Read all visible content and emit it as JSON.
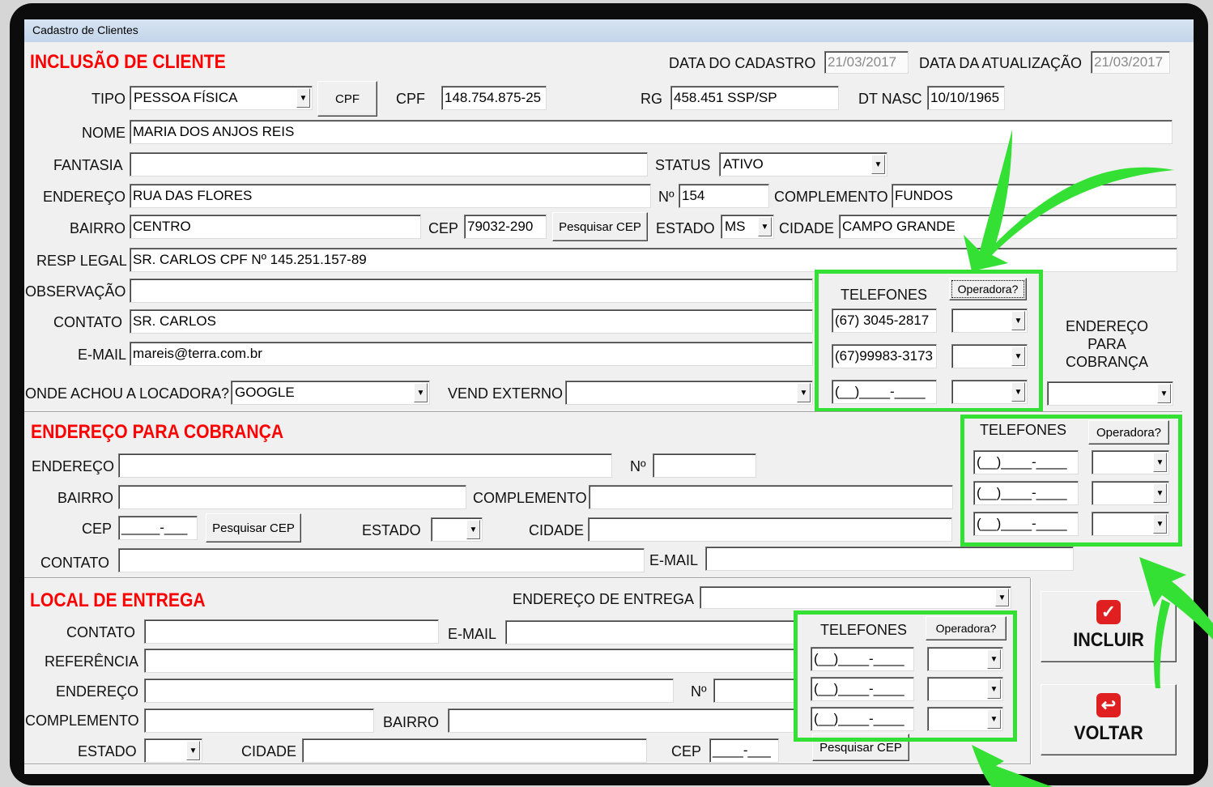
{
  "window": {
    "title": "Cadastro de Clientes"
  },
  "inclusao": {
    "header": "INCLUSÃO DE CLIENTE",
    "data_cadastro_label": "DATA DO CADASTRO",
    "data_cadastro": "21/03/2017",
    "data_atualizacao_label": "DATA DA ATUALIZAÇÃO",
    "data_atualizacao": "21/03/2017",
    "tipo_label": "TIPO",
    "tipo": "PESSOA FÍSICA",
    "cpf_button": "CPF",
    "cpf_label": "CPF",
    "cpf": "148.754.875-25",
    "rg_label": "RG",
    "rg": "458.451 SSP/SP",
    "dtnasc_label": "DT NASC",
    "dtnasc": "10/10/1965",
    "nome_label": "NOME",
    "nome": "MARIA DOS ANJOS REIS",
    "fantasia_label": "FANTASIA",
    "fantasia": "",
    "status_label": "STATUS",
    "status": "ATIVO",
    "endereco_label": "ENDEREÇO",
    "endereco": "RUA DAS FLORES",
    "numero_label": "Nº",
    "numero": "154",
    "complemento_label": "COMPLEMENTO",
    "complemento": "FUNDOS",
    "bairro_label": "BAIRRO",
    "bairro": "CENTRO",
    "cep_label": "CEP",
    "cep": "79032-290",
    "pesquisar_cep": "Pesquisar CEP",
    "estado_label": "ESTADO",
    "estado": "MS",
    "cidade_label": "CIDADE",
    "cidade": "CAMPO GRANDE",
    "resp_label": "RESP LEGAL",
    "resp": "SR. CARLOS CPF Nº 145.251.157-89",
    "obs_label": "OBSERVAÇÃO",
    "obs": "",
    "contato_label": "CONTATO",
    "contato": "SR. CARLOS",
    "email_label": "E-MAIL",
    "email": "mareis@terra.com.br",
    "onde_label": "ONDE ACHOU A LOCADORA?",
    "onde": "GOOGLE",
    "vend_label": "VEND EXTERNO",
    "vend": "",
    "telefones_label": "TELEFONES",
    "operadora_button": "Operadora?",
    "phones": [
      "(67) 3045-2817",
      "(67)99983-3173",
      "(__)____-____"
    ],
    "endereco_cobranca_label": "ENDEREÇO PARA COBRANÇA"
  },
  "cobranca": {
    "header": "ENDEREÇO PARA COBRANÇA",
    "endereco_label": "ENDEREÇO",
    "numero_label": "Nº",
    "bairro_label": "BAIRRO",
    "complemento_label": "COMPLEMENTO",
    "cep_label": "CEP",
    "cep": "_____-___",
    "pesquisar_cep": "Pesquisar CEP",
    "estado_label": "ESTADO",
    "cidade_label": "CIDADE",
    "contato_label": "CONTATO",
    "email_label": "E-MAIL",
    "telefones_label": "TELEFONES",
    "operadora_button": "Operadora?",
    "phones": [
      "(__)____-____",
      "(__)____-____",
      "(__)____-____"
    ]
  },
  "entrega": {
    "header": "LOCAL DE ENTREGA",
    "endereco_entrega_label": "ENDEREÇO DE ENTREGA",
    "contato_label": "CONTATO",
    "email_label": "E-MAIL",
    "referencia_label": "REFERÊNCIA",
    "endereco_label": "ENDEREÇO",
    "numero_label": "Nº",
    "complemento_label": "COMPLEMENTO",
    "bairro_label": "BAIRRO",
    "estado_label": "ESTADO",
    "cidade_label": "CIDADE",
    "cep_label": "CEP",
    "cep": "____-___",
    "pesquisar_cep": "Pesquisar CEP",
    "telefones_label": "TELEFONES",
    "operadora_button": "Operadora?",
    "phones": [
      "(__)____-____",
      "(__)____-____",
      "(__)____-____"
    ]
  },
  "actions": {
    "incluir": "INCLUIR",
    "voltar": "VOLTAR"
  },
  "icons": {
    "incluir": "checkmark-icon",
    "voltar": "return-arrow-icon"
  },
  "colors": {
    "header": "#ff0000",
    "highlight": "#33e033",
    "icon_bg": "#e02020"
  }
}
